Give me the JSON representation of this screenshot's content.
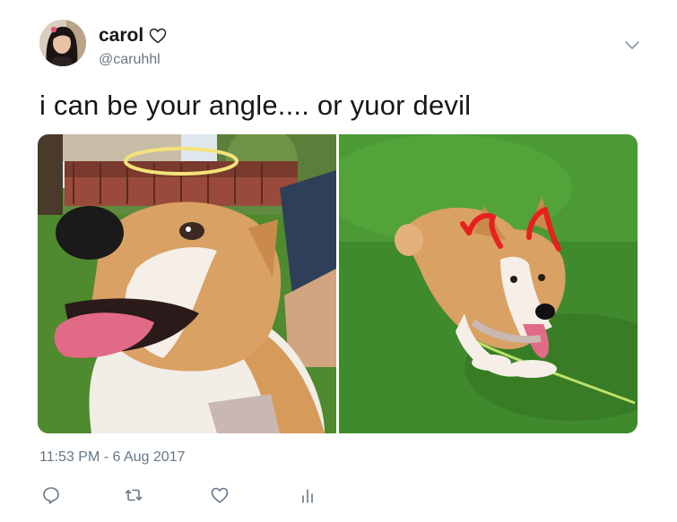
{
  "user": {
    "display_name": "carol",
    "handle": "@caruhhl"
  },
  "tweet": {
    "text": "i can be your angle.... or yuor devil",
    "timestamp": "11:53 PM - 6 Aug 2017"
  },
  "colors": {
    "text_primary": "#14171a",
    "text_secondary": "#657786",
    "halo": "#f4e27a",
    "horns": "#e8201e",
    "grass": "#3f8a2c"
  },
  "icons": {
    "header": [
      "heart-outline-icon",
      "chevron-down-icon"
    ],
    "actions": [
      "reply-icon",
      "retweet-icon",
      "like-icon",
      "analytics-icon"
    ]
  }
}
